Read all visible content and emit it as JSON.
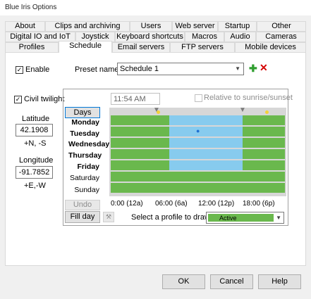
{
  "window": {
    "title": "Blue Iris Options"
  },
  "tabs": {
    "row1": [
      "About",
      "Clips and archiving",
      "Users",
      "Web server",
      "Startup",
      "Other"
    ],
    "row2": [
      "Digital IO and IoT",
      "Joystick",
      "Keyboard shortcuts",
      "Macros",
      "Audio",
      "Cameras"
    ],
    "row3": [
      "Profiles",
      "Schedule",
      "Email servers",
      "FTP servers",
      "Mobile devices"
    ],
    "active": "Schedule"
  },
  "schedule": {
    "enable_label": "Enable",
    "enable_checked": true,
    "preset_label": "Preset names:",
    "preset_value": "Schedule 1",
    "civil_twilight_label": "Civil twilight",
    "civil_twilight_checked": true,
    "latitude_label": "Latitude",
    "latitude_value": "42.1908",
    "latitude_hint": "+N, -S",
    "longitude_label": "Longitude",
    "longitude_value": "-91.7852",
    "longitude_hint": "+E,-W",
    "time_value": "11:54 AM",
    "relative_label": "Relative to sunrise/sunset",
    "relative_checked": false,
    "days_button": "Days",
    "days": [
      {
        "label": "Monday",
        "bold": true
      },
      {
        "label": "Tuesday",
        "bold": true
      },
      {
        "label": "Wednesday",
        "bold": true
      },
      {
        "label": "Thursday",
        "bold": true
      },
      {
        "label": "Friday",
        "bold": true
      },
      {
        "label": "Saturday",
        "bold": false
      },
      {
        "label": "Sunday",
        "bold": false
      }
    ],
    "time_ticks": [
      "0:00 (12a)",
      "06:00 (6a)",
      "12:00 (12p)",
      "18:00 (6p)"
    ],
    "undo_button": "Undo",
    "fill_day_button": "Fill day",
    "draw_profile_label": "Select a profile to draw:",
    "draw_profile_value": "Active",
    "profile_colors": {
      "active": "#6ab84d",
      "away": "#87cbee"
    }
  },
  "footer": {
    "ok": "OK",
    "cancel": "Cancel",
    "help": "Help"
  }
}
